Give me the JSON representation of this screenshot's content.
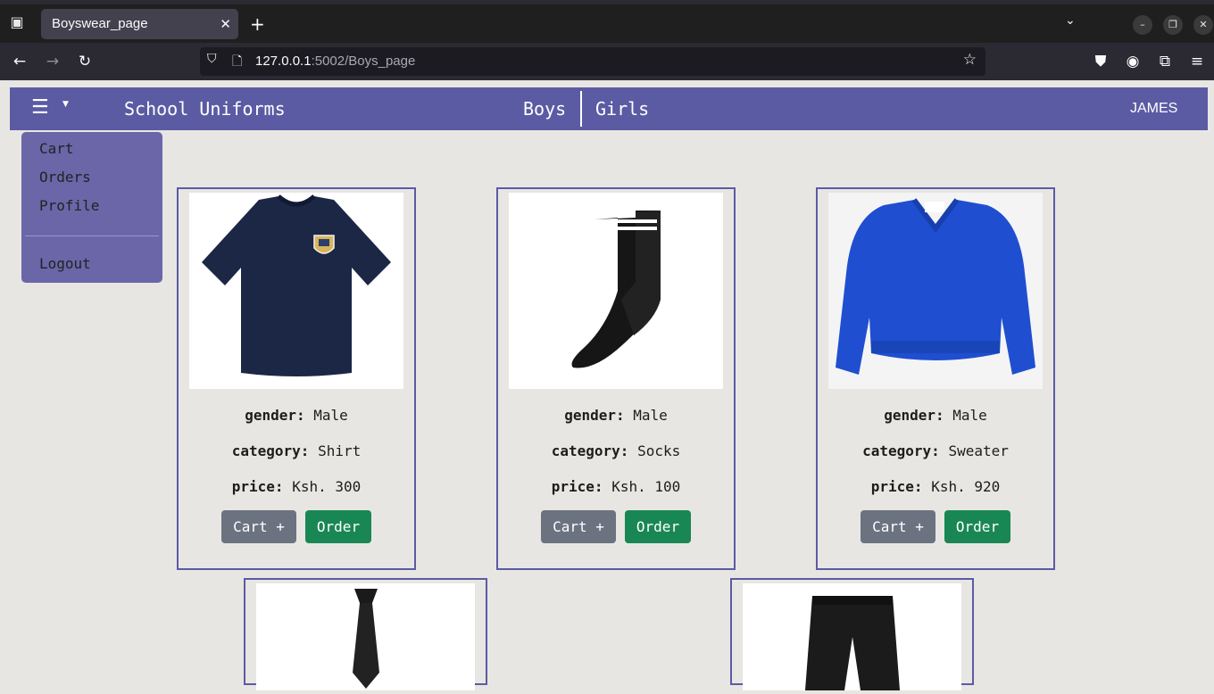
{
  "browser": {
    "tab_title": "Boyswear_page",
    "url_host": "127.0.0.1",
    "url_rest": ":5002/Boys_page"
  },
  "header": {
    "brand": "School Uniforms",
    "nav": {
      "boys": "Boys",
      "girls": "Girls"
    },
    "user": "JAMES"
  },
  "dropdown": {
    "items": [
      "Cart",
      "Orders",
      "Profile"
    ],
    "logout": "Logout"
  },
  "labels": {
    "gender": "gender:",
    "category": "category:",
    "price": "price:",
    "cart_button": "Cart +",
    "order_button": "Order"
  },
  "products": [
    {
      "gender": "Male",
      "category": "Shirt",
      "price": "Ksh. 300",
      "image": "navy-tshirt"
    },
    {
      "gender": "Male",
      "category": "Socks",
      "price": "Ksh. 100",
      "image": "black-sock"
    },
    {
      "gender": "Male",
      "category": "Sweater",
      "price": "Ksh. 920",
      "image": "blue-sweater"
    },
    {
      "image": "black-tie"
    },
    {
      "image": "black-shorts"
    }
  ],
  "colors": {
    "header_bg": "#5b5ba4",
    "dropdown_bg": "#6a66a8",
    "cart_button": "#6b7280",
    "order_button": "#198754",
    "page_bg": "#e8e6e3"
  }
}
